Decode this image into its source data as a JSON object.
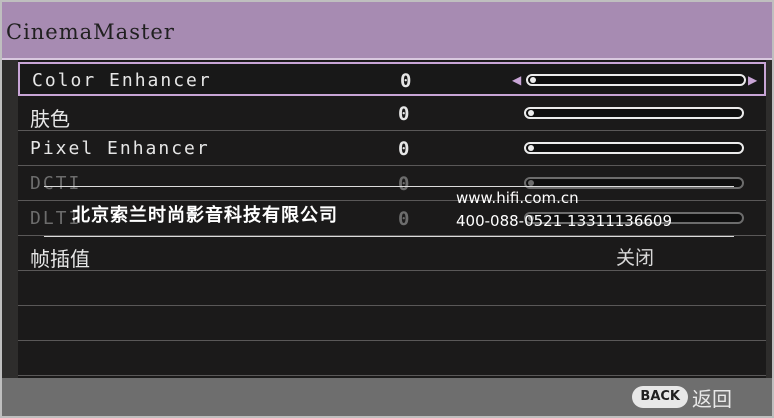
{
  "title": "CinemaMaster",
  "rows": [
    {
      "label": "Color Enhancer",
      "value": "0",
      "slider": 0.0,
      "selected": true
    },
    {
      "label": "肤色",
      "value": "0",
      "slider": 0.0
    },
    {
      "label": "Pixel Enhancer",
      "value": "0",
      "slider": 0.0
    },
    {
      "label": "DCTI",
      "value": "0",
      "slider": 0.0
    },
    {
      "label": "DLTI",
      "value": "0",
      "slider": 0.0
    },
    {
      "label": "帧插值",
      "value": "关闭"
    }
  ],
  "footer": {
    "back_button": "BACK",
    "back_text": "返回"
  },
  "watermark": {
    "company": "北京索兰时尚影音科技有限公司",
    "url": "www.hifi.com.cn",
    "phone": "400-088-0521  13311136609"
  },
  "colors": {
    "title_bar": "#a78bb2",
    "selection": "#c8a5d6"
  }
}
